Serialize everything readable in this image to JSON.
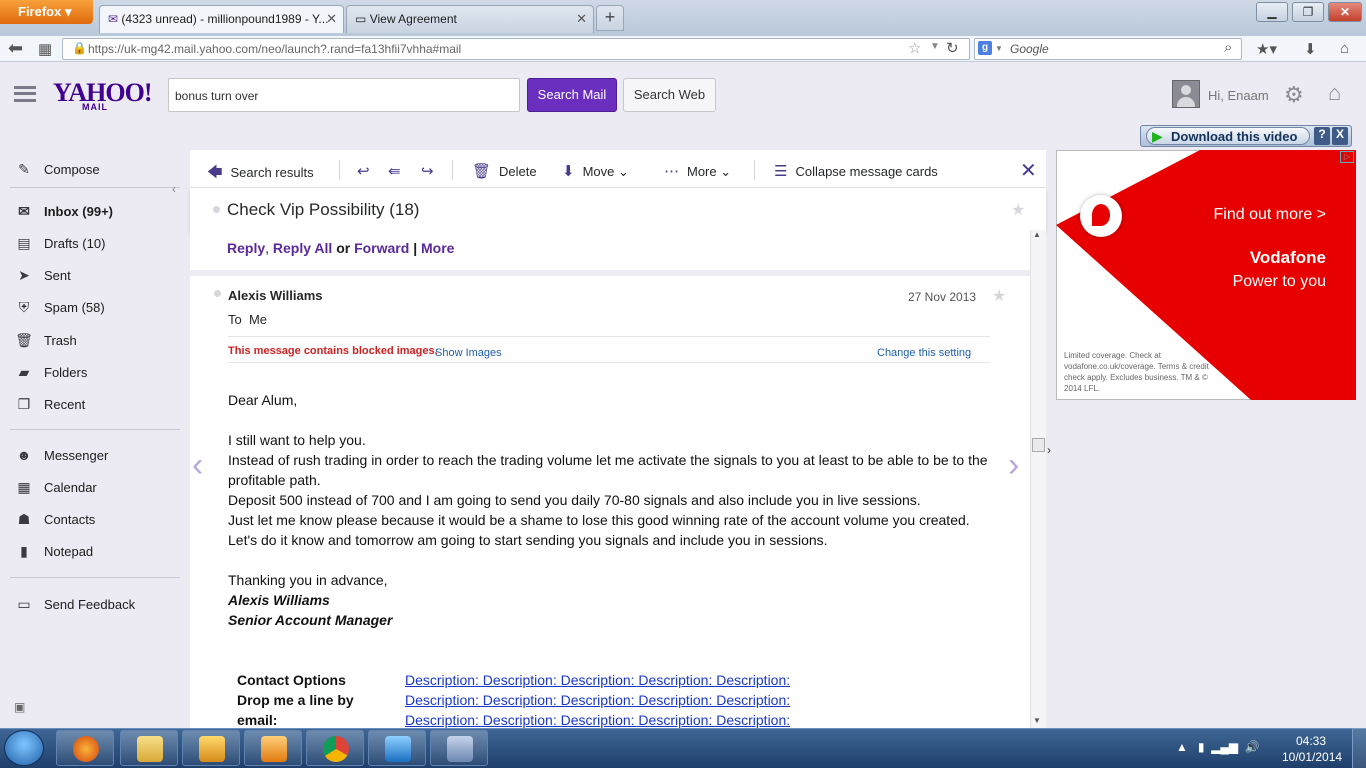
{
  "browser": {
    "firefox_label": "Firefox",
    "tabs": [
      {
        "title": "(4323 unread) - millionpound1989 - Y..."
      },
      {
        "title": "View Agreement"
      }
    ],
    "url": "https://uk-mg42.mail.yahoo.com/neo/launch?.rand=fa13hfii7vhha#mail",
    "search_engine": "Google"
  },
  "yahoo": {
    "logo": "YAHOO!",
    "logo_sub": "MAIL",
    "search_value": "bonus turn over",
    "search_mail_label": "Search Mail",
    "search_web_label": "Search Web",
    "greeting": "Hi, Enaam"
  },
  "sidebar": {
    "items": [
      {
        "label": "Compose",
        "icon": "compose-icon"
      },
      {
        "label": "Inbox (99+)",
        "icon": "inbox-icon"
      },
      {
        "label": "Drafts (10)",
        "icon": "drafts-icon"
      },
      {
        "label": "Sent",
        "icon": "sent-icon"
      },
      {
        "label": "Spam (58)",
        "icon": "spam-icon"
      },
      {
        "label": "Trash",
        "icon": "trash-icon"
      },
      {
        "label": "Folders",
        "icon": "folder-icon"
      },
      {
        "label": "Recent",
        "icon": "recent-icon"
      },
      {
        "label": "Messenger",
        "icon": "messenger-icon"
      },
      {
        "label": "Calendar",
        "icon": "calendar-icon"
      },
      {
        "label": "Contacts",
        "icon": "contacts-icon"
      },
      {
        "label": "Notepad",
        "icon": "notepad-icon"
      },
      {
        "label": "Send Feedback",
        "icon": "feedback-icon"
      }
    ]
  },
  "toolbar": {
    "search_results": "Search results",
    "delete": "Delete",
    "move": "Move",
    "more": "More",
    "collapse": "Collapse message cards"
  },
  "thread": {
    "subject": "Check Vip Possibility (18)",
    "reply": "Reply",
    "reply_all": "Reply All",
    "or": "or",
    "forward": "Forward",
    "sep": "|",
    "more": "More"
  },
  "message": {
    "sender": "Alexis Williams",
    "date": "27 Nov 2013",
    "to_label": "To",
    "to_value": "Me",
    "blocked": "This message contains blocked images.",
    "show_images": "Show Images",
    "change_setting": "Change this setting",
    "greeting": "Dear Alum,",
    "paragraphs": [
      "I still want to help you.",
      "Instead of rush trading in order to reach the trading volume let me activate the signals to you at least to be able to be to the profitable path.",
      "Deposit 500 instead of 700 and I am going to send you daily 70-80 signals and also include you in live sessions.",
      "Just let me know please because it would be a shame to lose this good winning rate of the account volume you created.",
      "Let's do it know and tomorrow am going to start sending you signals and include you in sessions."
    ],
    "closing": "Thanking you in advance,",
    "sig_name": "Alexis Williams",
    "sig_title": "Senior Account Manager",
    "contact_options": "Contact Options",
    "drop_line": "Drop me a line by email:",
    "desc_link": "Description: Description: Description: Description: Description:"
  },
  "download": {
    "label": "Download this video",
    "help": "?",
    "close": "X"
  },
  "ad": {
    "find_out": "Find out more >",
    "brand": "Vodafone",
    "tagline": "Power to you",
    "small_print": "Limited coverage. Check at vodafone.co.uk/coverage. Terms & credit check apply. Excludes business. TM & © 2014 LFL."
  },
  "taskbar": {
    "time": "04:33",
    "date": "10/01/2014"
  }
}
